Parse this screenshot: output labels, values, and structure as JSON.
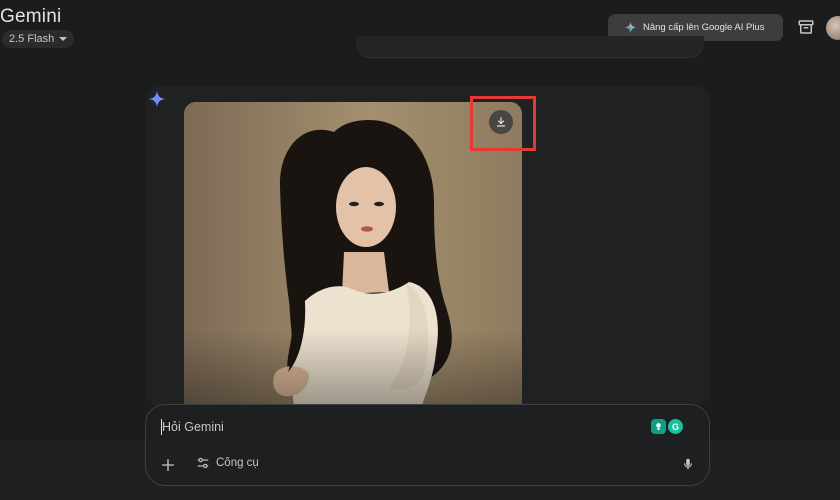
{
  "header": {
    "app_title": "Gemini",
    "model": "2.5 Flash",
    "upgrade_label": "Nâng cấp lên Google AI Plus"
  },
  "response": {
    "image_alt": "Ảnh chân dung người phụ nữ tóc dài mặc áo len trắng"
  },
  "composer": {
    "placeholder": "Hỏi Gemini",
    "tools_label": "Công cụ",
    "badge_b": "G"
  },
  "colors": {
    "background": "#1b1c1d",
    "card": "#202122",
    "highlight": "#e53935",
    "sparkle": "#6e8efb"
  },
  "icons": [
    "gemini-sparkle-icon",
    "archive-icon",
    "download-icon",
    "plus-icon",
    "tools-icon",
    "mic-icon",
    "caret-down-icon"
  ]
}
